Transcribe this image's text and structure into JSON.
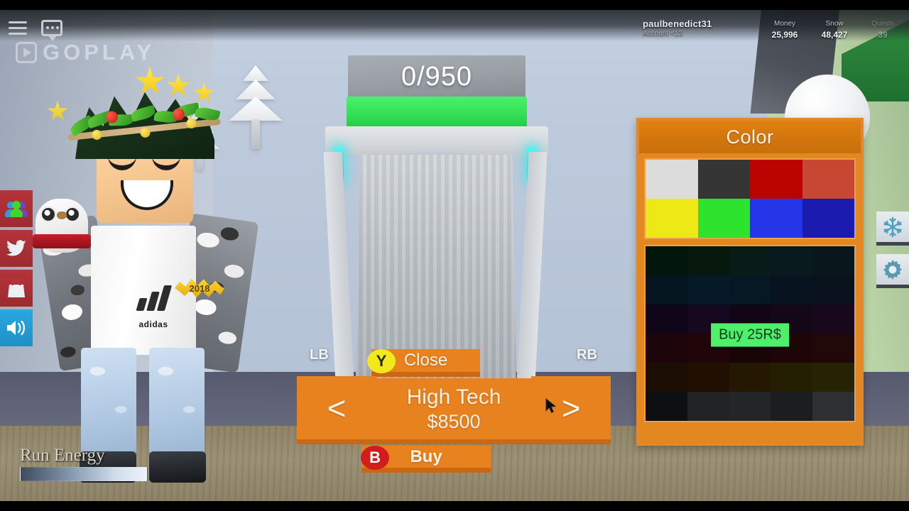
{
  "watermark": {
    "text": "GOPLAY",
    "play_icon": "play-icon"
  },
  "topbar": {
    "player": {
      "name": "paulbenedict31",
      "account": "Account <13"
    },
    "stats": [
      {
        "label": "Money",
        "value": "25,996"
      },
      {
        "label": "Snow",
        "value": "48,427"
      },
      {
        "label": "Quests",
        "value": "39"
      }
    ]
  },
  "left_rail": [
    {
      "name": "friends-icon",
      "label": "Friends"
    },
    {
      "name": "twitter-icon",
      "label": "Twitter"
    },
    {
      "name": "shop-bag-icon",
      "label": "Shop"
    },
    {
      "name": "sound-icon",
      "label": "Sound"
    }
  ],
  "right_rail": [
    {
      "name": "snowflake-icon",
      "label": "Snow"
    },
    {
      "name": "gear-icon",
      "label": "Settings"
    }
  ],
  "machine": {
    "counter": "0/950"
  },
  "hud": {
    "run_energy_label": "Run Energy",
    "run_energy_percent": 100
  },
  "color_panel": {
    "title": "Color",
    "unlocked_swatches": [
      "#DCDCDC",
      "#353535",
      "#BB0400",
      "#C84732",
      "#EFE817",
      "#2EE32E",
      "#2436E8",
      "#1B1BB0"
    ],
    "locked_swatches": [
      "#0B4A24",
      "#17542B",
      "#1B5B4E",
      "#1C5560",
      "#1E4A5E",
      "#15496B",
      "#10537F",
      "#124F73",
      "#173F63",
      "#1B3A5C",
      "#3A1257",
      "#4A1A66",
      "#3B1045",
      "#44174F",
      "#521A5E",
      "#5A0E22",
      "#6B0F26",
      "#571014",
      "#631419",
      "#6E1A1F",
      "#5E2A07",
      "#6E3208",
      "#7A5108",
      "#77670B",
      "#7E7310",
      "#2B3138",
      "#6E7276",
      "#777B7E",
      "#5D6165",
      "#9AA0A4"
    ],
    "buy_robux_label": "Buy 25R$"
  },
  "shop": {
    "close_label": "Close",
    "prev_label": "<",
    "next_label": ">",
    "item_name": "High Tech",
    "item_price": "$8500",
    "buy_label": "Buy",
    "gamepad": {
      "lb": "LB",
      "rb": "RB",
      "y_button": "Y",
      "b_button": "B"
    }
  }
}
